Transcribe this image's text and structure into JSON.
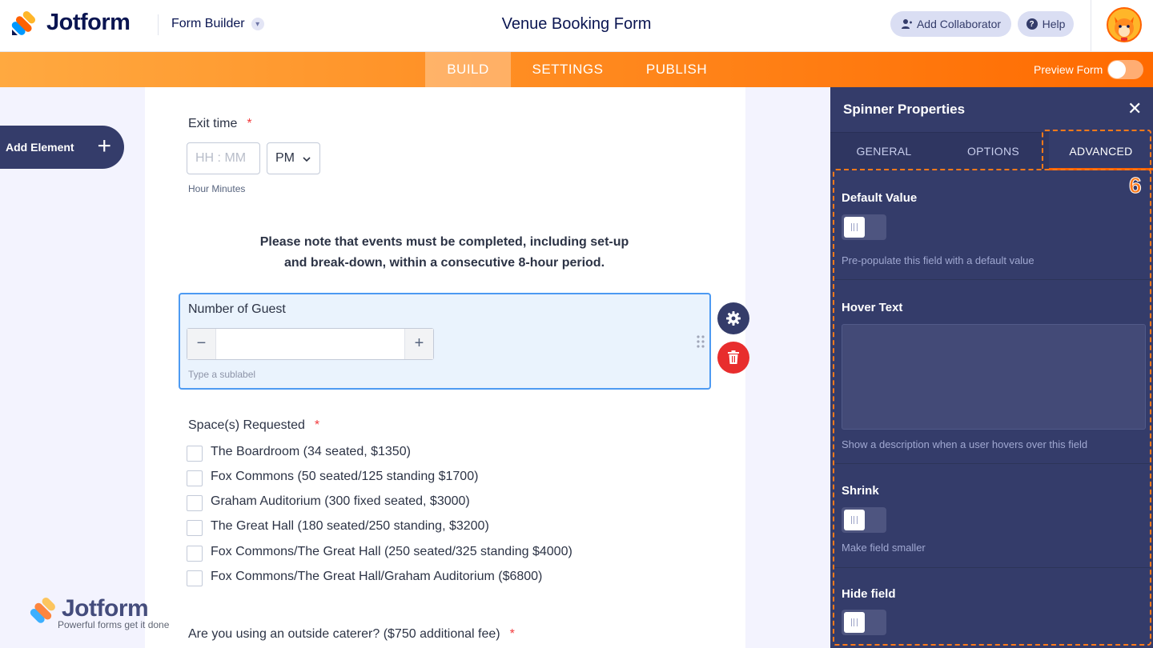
{
  "header": {
    "brand": "Jotform",
    "section": "Form Builder",
    "form_title": "Venue Booking Form",
    "add_collaborator": "Add Collaborator",
    "help": "Help"
  },
  "nav": {
    "tabs": [
      "BUILD",
      "SETTINGS",
      "PUBLISH"
    ],
    "active_tab": "BUILD",
    "preview_label": "Preview Form"
  },
  "sidebar": {
    "add_element": "Add Element"
  },
  "form": {
    "exit_time": {
      "label": "Exit time",
      "required_mark": "*",
      "placeholder": "HH : MM",
      "ampm": "PM",
      "sublabel": "Hour Minutes"
    },
    "notice_line1": "Please note that events must be completed, including set-up",
    "notice_line2": "and break-down, within a consecutive 8-hour period.",
    "guests": {
      "label": "Number of Guest",
      "minus": "−",
      "plus": "+",
      "sublabel_placeholder": "Type a sublabel"
    },
    "spaces": {
      "label": "Space(s) Requested",
      "required_mark": "*",
      "options": [
        "The Boardroom (34 seated, $1350)",
        "Fox Commons (50 seated/125 standing $1700)",
        "Graham Auditorium (300 fixed seated, $3000)",
        "The Great Hall (180 seated/250 standing, $3200)",
        "Fox Commons/The Great Hall (250 seated/325 standing $4000)",
        "Fox Commons/The Great Hall/Graham Auditorium ($6800)"
      ]
    },
    "caterer": {
      "label": "Are you using an outside caterer? ($750 additional fee)",
      "required_mark": "*"
    },
    "watermark": {
      "brand": "Jotform",
      "tagline": "Powerful forms get it done"
    }
  },
  "panel": {
    "title": "Spinner Properties",
    "close": "✕",
    "tabs": [
      "GENERAL",
      "OPTIONS",
      "ADVANCED"
    ],
    "active_tab": "ADVANCED",
    "annotation_number": "6",
    "default_value": {
      "title": "Default Value",
      "desc": "Pre-populate this field with a default value",
      "enabled": false
    },
    "hover_text": {
      "title": "Hover Text",
      "value": "",
      "desc": "Show a description when a user hovers over this field"
    },
    "shrink": {
      "title": "Shrink",
      "desc": "Make field smaller",
      "enabled": false
    },
    "hide_field": {
      "title": "Hide field",
      "enabled": false
    }
  },
  "colors": {
    "brand_orange": "#ff6100",
    "panel_bg": "#343c6a",
    "selection_blue": "#4d9af2",
    "delete_red": "#e82d2d"
  }
}
